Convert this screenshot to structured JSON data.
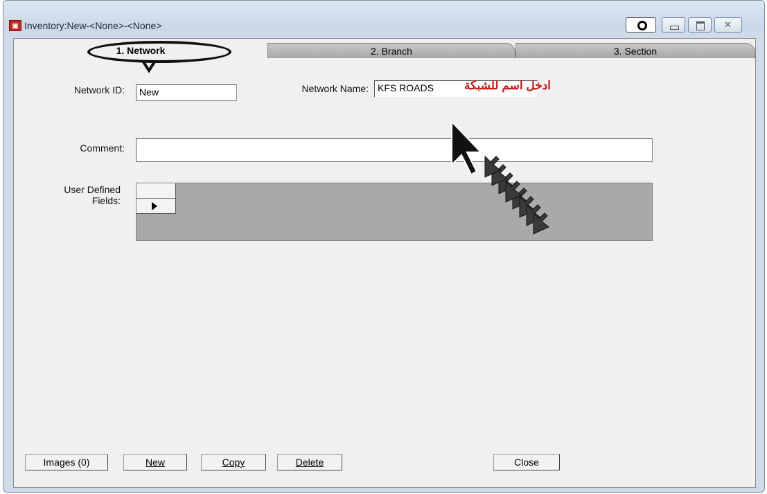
{
  "window": {
    "title": "Inventory:New-<None>-<None>",
    "app_icon": "inventory-app-icon",
    "controls": [
      "pin-icon",
      "minimize-icon",
      "maximize-icon",
      "close-icon"
    ]
  },
  "tabs": [
    {
      "label": "1. Network",
      "active": true
    },
    {
      "label": "2. Branch",
      "active": false
    },
    {
      "label": "3. Section",
      "active": false
    }
  ],
  "form": {
    "network_id_label": "Network ID:",
    "network_id_value": "New",
    "network_name_label": "Network Name:",
    "network_name_value": "KFS ROADS",
    "network_name_hint": "ادخل اسم للشبكة",
    "comment_label": "Comment:",
    "comment_value": "",
    "udf_label_line1": "User Defined",
    "udf_label_line2": "Fields:"
  },
  "buttons": {
    "images": "Images (0)",
    "new": "New",
    "copy": "Copy",
    "delete": "Delete",
    "close": "Close"
  },
  "colors": {
    "hint_text": "#d21414",
    "inactive_tab": "#a6a6a6",
    "grid_bg": "#a9a9a9"
  }
}
